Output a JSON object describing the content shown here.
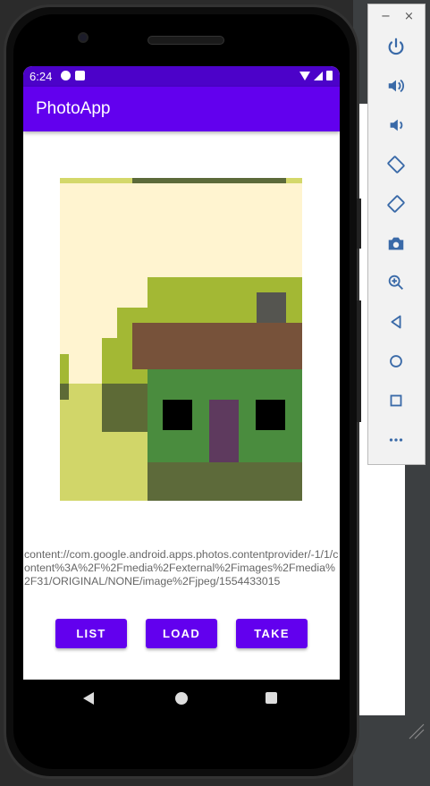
{
  "status_bar": {
    "time": "6:24",
    "icons_left": [
      "notification-p-icon",
      "sd-card-icon"
    ],
    "icons_right": [
      "wifi-icon",
      "signal-icon",
      "battery-icon"
    ]
  },
  "app": {
    "title": "PhotoApp",
    "accent_color": "#6200ee",
    "status_color": "#4c02c9"
  },
  "photo_uri": "content://com.google.android.apps.photos.contentprovider/-1/1/content%3A%2F%2Fmedia%2Fexternal%2Fimages%2Fmedia%2F31/ORIGINAL/NONE/image%2Fjpeg/1554433015",
  "buttons": {
    "list": "LIST",
    "load": "LOAD",
    "take": "TAKE"
  },
  "nav_bar": [
    "back-icon",
    "home-icon",
    "recent-apps-icon"
  ],
  "emulator_toolbar": {
    "window_controls": {
      "minimize": "−",
      "close": "×"
    },
    "items": [
      "power-icon",
      "volume-up-icon",
      "volume-down-icon",
      "rotate-left-icon",
      "rotate-right-icon",
      "camera-icon",
      "zoom-icon",
      "back-icon",
      "home-icon",
      "overview-icon",
      "more-icon"
    ]
  }
}
